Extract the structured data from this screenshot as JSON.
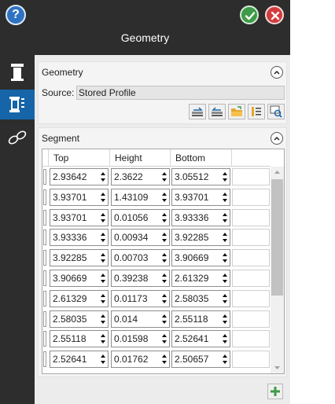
{
  "window": {
    "title": "Geometry",
    "help_label": "?",
    "accent_color": "#1565a8",
    "ok_color": "#3e9b47",
    "cancel_color": "#d23c3c"
  },
  "sidebar": {
    "tabs": [
      {
        "icon": "column-icon",
        "active": false
      },
      {
        "icon": "geometry-profile-icon",
        "active": true
      },
      {
        "icon": "link-icon",
        "active": false
      }
    ]
  },
  "geometry_section": {
    "title": "Geometry",
    "source_label": "Source:",
    "source_value": "Stored Profile",
    "tools": [
      "import-profile-icon",
      "export-profile-icon",
      "open-folder-icon",
      "table-settings-icon",
      "preview-icon"
    ]
  },
  "segment_section": {
    "title": "Segment",
    "columns": [
      "Top",
      "Height",
      "Bottom"
    ],
    "rows": [
      [
        "2.93642",
        "2.3622",
        "3.05512"
      ],
      [
        "3.93701",
        "1.43109",
        "3.93701"
      ],
      [
        "3.93701",
        "0.01056",
        "3.93336"
      ],
      [
        "3.93336",
        "0.00934",
        "3.92285"
      ],
      [
        "3.92285",
        "0.00703",
        "3.90669"
      ],
      [
        "3.90669",
        "0.39238",
        "2.61329"
      ],
      [
        "2.61329",
        "0.01173",
        "2.58035"
      ],
      [
        "2.58035",
        "0.014",
        "2.55118"
      ],
      [
        "2.55118",
        "0.01598",
        "2.52641"
      ],
      [
        "2.52641",
        "0.01762",
        "2.50657"
      ]
    ]
  }
}
